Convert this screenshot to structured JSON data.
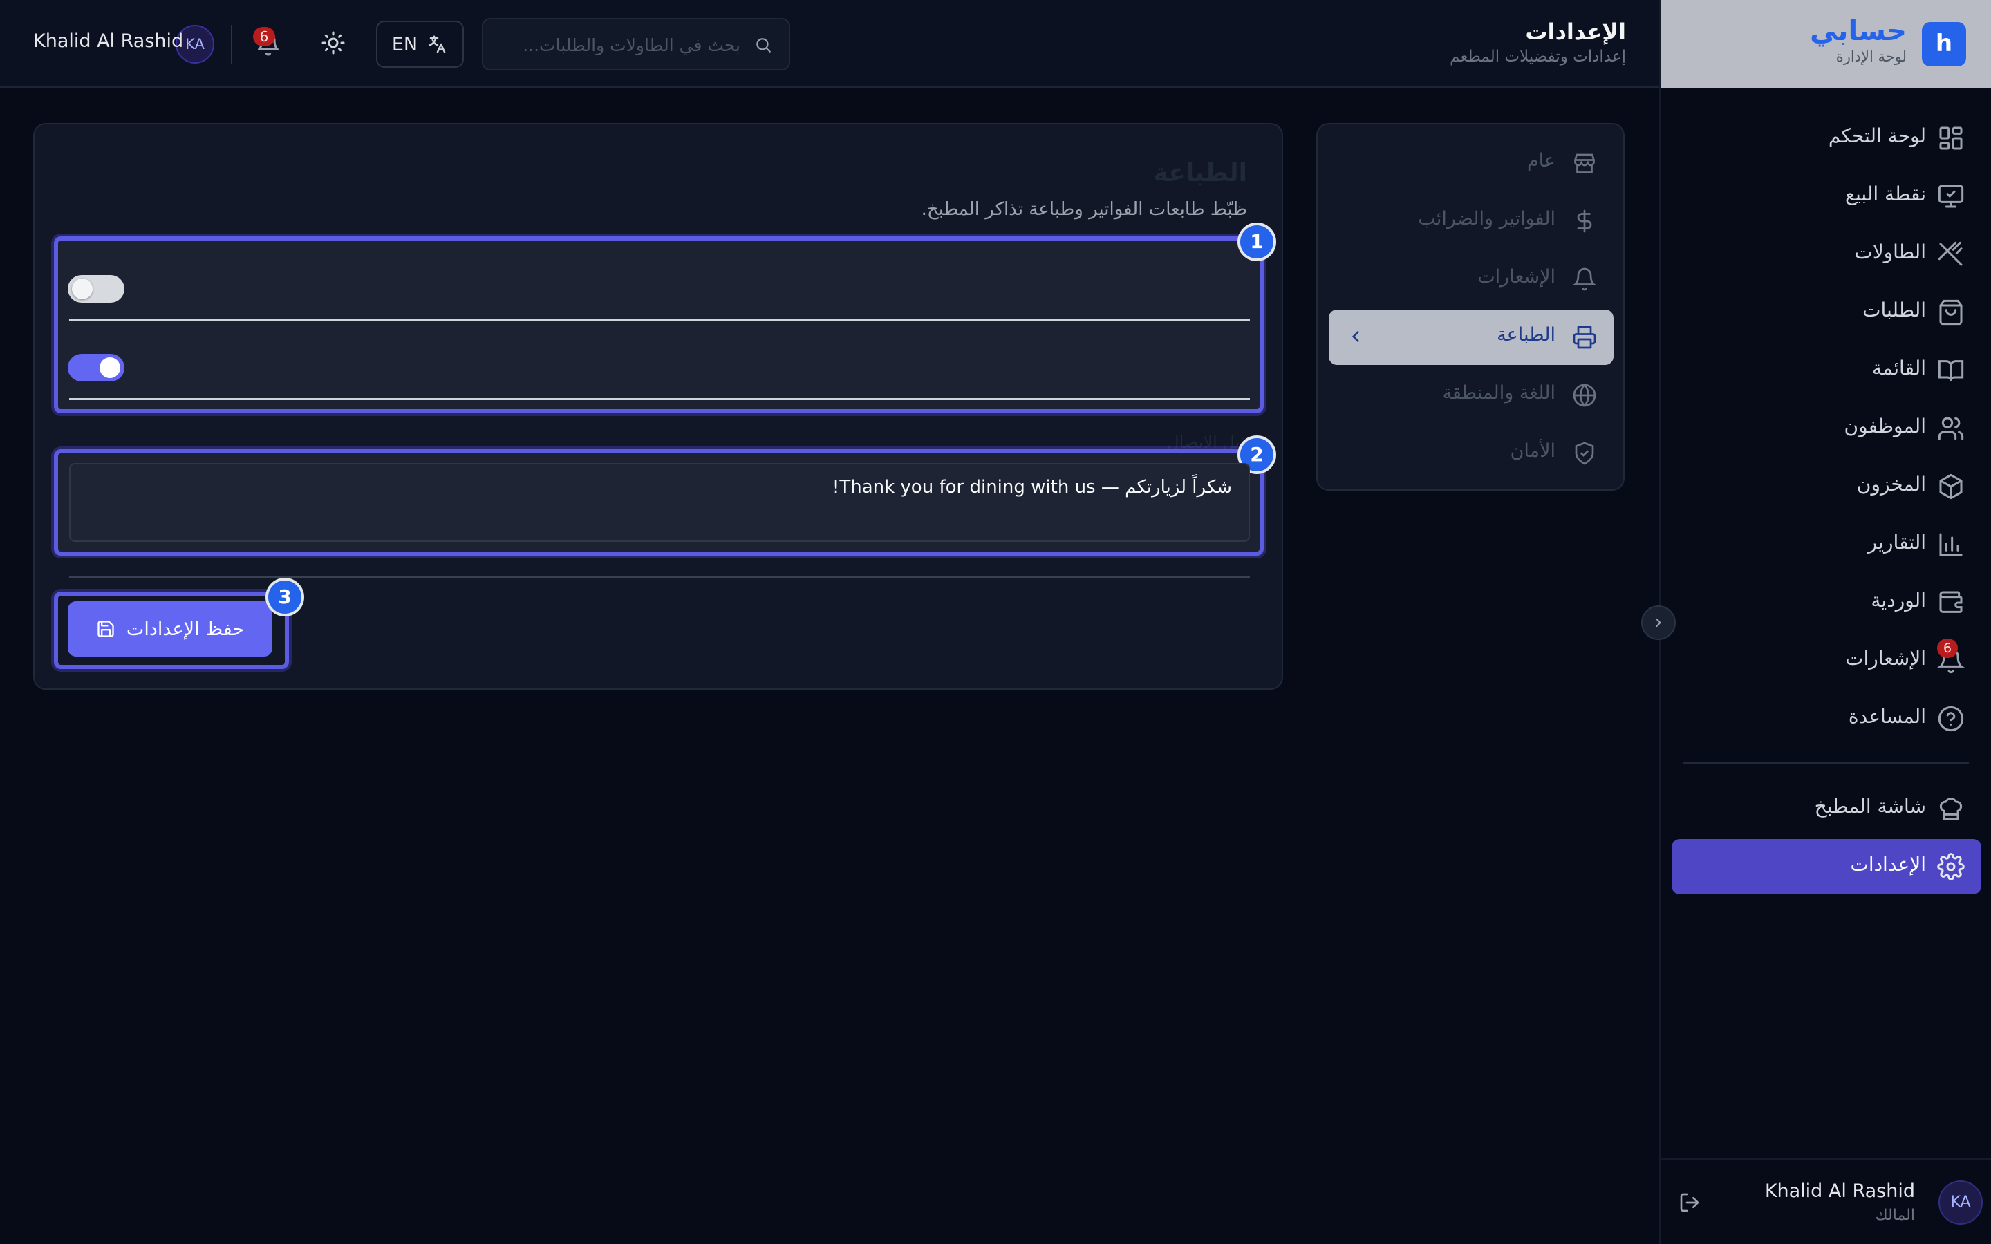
{
  "header": {
    "title": "الإعدادات",
    "subtitle": "إعدادات وتفضيلات المطعم",
    "search_placeholder": "بحث في الطاولات والطلبات...",
    "lang_label": "EN",
    "notification_count": "6",
    "user_initials": "KA",
    "user_name": "Khalid Al Rashid"
  },
  "brand": {
    "logo_letter": "h",
    "name": "حسابي",
    "subtitle": "لوحة الإدارة"
  },
  "sidebar": {
    "items": [
      {
        "label": "لوحة التحكم",
        "icon": "dashboard-icon"
      },
      {
        "label": "نقطة البيع",
        "icon": "monitor-icon"
      },
      {
        "label": "الطاولات",
        "icon": "utensils-icon"
      },
      {
        "label": "الطلبات",
        "icon": "shopping-bag-icon"
      },
      {
        "label": "القائمة",
        "icon": "book-icon"
      },
      {
        "label": "الموظفون",
        "icon": "users-icon"
      },
      {
        "label": "المخزون",
        "icon": "package-icon"
      },
      {
        "label": "التقارير",
        "icon": "bar-chart-icon"
      },
      {
        "label": "الوردية",
        "icon": "wallet-icon"
      },
      {
        "label": "الإشعارات",
        "icon": "bell-icon",
        "badge": "6"
      },
      {
        "label": "المساعدة",
        "icon": "help-icon"
      }
    ],
    "extra_items": [
      {
        "label": "شاشة المطبخ",
        "icon": "chef-hat-icon"
      },
      {
        "label": "الإعدادات",
        "icon": "settings-icon",
        "active": true
      }
    ],
    "footer": {
      "initials": "KA",
      "name": "Khalid Al Rashid",
      "role": "المالك"
    }
  },
  "settings_nav": {
    "items": [
      {
        "label": "عام",
        "icon": "store-icon"
      },
      {
        "label": "الفواتير والضرائب",
        "icon": "dollar-icon"
      },
      {
        "label": "الإشعارات",
        "icon": "bell-icon"
      },
      {
        "label": "الطباعة",
        "icon": "printer-icon",
        "active": true
      },
      {
        "label": "اللغة والمنطقة",
        "icon": "globe-icon"
      },
      {
        "label": "الأمان",
        "icon": "shield-icon"
      }
    ]
  },
  "printing": {
    "title": "الطباعة",
    "description": "ظبّط طابعات الفواتير وطباعة تذاكر المطبخ.",
    "toggles": [
      {
        "state": "off"
      },
      {
        "state": "on"
      }
    ],
    "footer_label": "ذيل الإيصال",
    "footer_value": "شكراً لزيارتكم — Thank you for dining with us!",
    "save_label": "حفظ الإعدادات"
  },
  "annotations": [
    "1",
    "2",
    "3"
  ],
  "colors": {
    "accent": "#6366f1",
    "active_nav": "#4f46c5",
    "brand_blue": "#2563eb",
    "badge_red": "#b91c1c"
  }
}
